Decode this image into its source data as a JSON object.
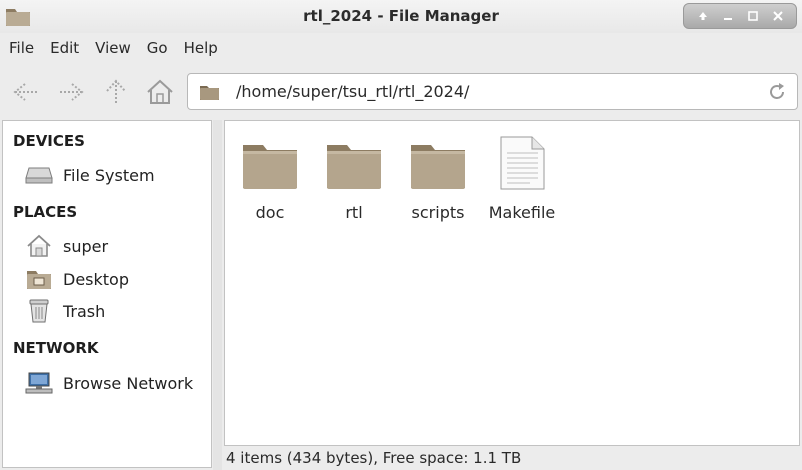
{
  "window": {
    "title": "rtl_2024 - File Manager",
    "icon": "folder-icon",
    "controls": [
      "restore-icon",
      "minimize-icon",
      "maximize-icon",
      "close-icon"
    ]
  },
  "menubar": {
    "items": [
      "File",
      "Edit",
      "View",
      "Go",
      "Help"
    ]
  },
  "toolbar": {
    "buttons": [
      "back-icon",
      "forward-icon",
      "up-icon",
      "home-icon"
    ]
  },
  "location": {
    "path": "/home/super/tsu_rtl/rtl_2024/"
  },
  "sidebar": {
    "sections": [
      {
        "heading": "DEVICES",
        "items": [
          {
            "label": "File System",
            "icon": "drive-icon"
          }
        ]
      },
      {
        "heading": "PLACES",
        "items": [
          {
            "label": "super",
            "icon": "home-icon"
          },
          {
            "label": "Desktop",
            "icon": "desktop-folder-icon"
          },
          {
            "label": "Trash",
            "icon": "trash-icon"
          }
        ]
      },
      {
        "heading": "NETWORK",
        "items": [
          {
            "label": "Browse Network",
            "icon": "network-icon"
          }
        ]
      }
    ]
  },
  "files": [
    {
      "name": "doc",
      "type": "folder"
    },
    {
      "name": "rtl",
      "type": "folder"
    },
    {
      "name": "scripts",
      "type": "folder"
    },
    {
      "name": "Makefile",
      "type": "file"
    }
  ],
  "status": {
    "text": "4 items (434 bytes), Free space: 1.1 TB"
  },
  "colors": {
    "folder": "#a8987f",
    "folder_tab": "#8d7c62",
    "window_bg": "#ececec",
    "panel_bg": "#ffffff"
  }
}
